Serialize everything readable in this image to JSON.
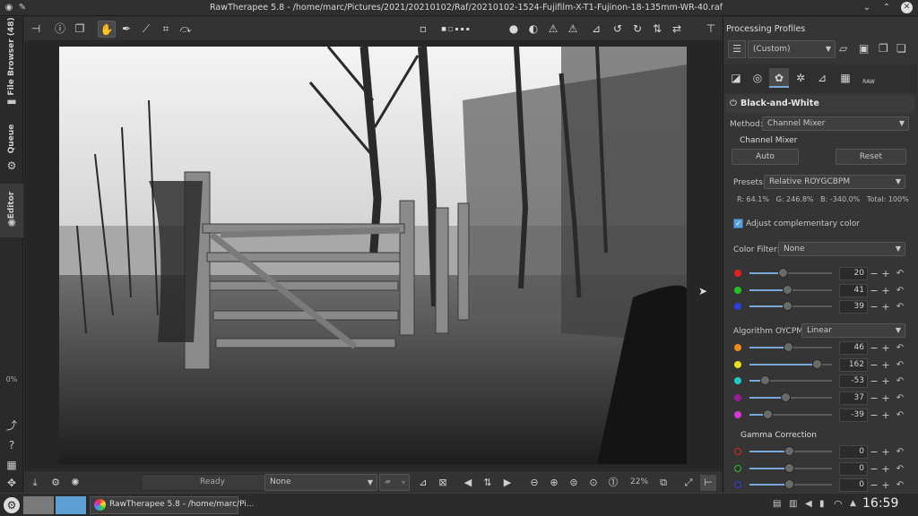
{
  "window": {
    "title": "RawTherapee 5.8 - /home/marc/Pictures/2021/20210102/Raf/20210102-1524-Fujifilm-X-T1-Fujinon-18-135mm-WR-40.raf"
  },
  "left_tabs": {
    "file_browser": "File Browser (48)",
    "queue": "Queue",
    "editor": "Editor",
    "progress": "0%"
  },
  "status": {
    "ready": "Ready",
    "profile_select": "None",
    "zoom": "22%"
  },
  "right": {
    "processing_profiles": "Processing Profiles",
    "profile_value": "(Custom)",
    "raw_tab_label": "RAW",
    "tool_title": "Black-and-White",
    "method_label": "Method:",
    "method_value": "Channel Mixer",
    "channel_mixer": "Channel Mixer",
    "auto": "Auto",
    "reset": "Reset",
    "presets_label": "Presets:",
    "presets_value": "Relative ROYGCBPM",
    "rgb_readout": "R: 64.1%   G: 246.8%   B: -340.0%   Total: 100%",
    "adjust_complementary": "Adjust complementary color",
    "adjust_checked": true,
    "color_filter_label": "Color Filter:",
    "color_filter_value": "None",
    "algorithm_label": "Algorithm OYCPM:",
    "algorithm_value": "Linear",
    "gamma_title": "Gamma Correction"
  },
  "sliders": {
    "mixer_rgb": [
      {
        "color": "#e02020",
        "value": "20",
        "fraction": 0.4
      },
      {
        "color": "#22c022",
        "value": "41",
        "fraction": 0.46
      },
      {
        "color": "#2a3fe0",
        "value": "39",
        "fraction": 0.46
      }
    ],
    "oycpm": [
      {
        "color": "#f08a1e",
        "value": "46",
        "fraction": 0.47
      },
      {
        "color": "#e6e020",
        "value": "162",
        "fraction": 0.82
      },
      {
        "color": "#20c8c8",
        "value": "-53",
        "fraction": 0.18
      },
      {
        "color": "#9a1a9a",
        "value": "37",
        "fraction": 0.44
      },
      {
        "color": "#d838d8",
        "value": "-39",
        "fraction": 0.22
      }
    ],
    "gamma": [
      {
        "color": "#e02020",
        "value": "0",
        "fraction": 0.48
      },
      {
        "color": "#22c022",
        "value": "0",
        "fraction": 0.48
      },
      {
        "color": "#2a3fe0",
        "value": "0",
        "fraction": 0.48
      }
    ]
  },
  "taskbar": {
    "app_label": "RawTherapee 5.8 - /home/marc/Pi...",
    "clock": "16:59"
  },
  "colors": {
    "accent": "#7aa7d9",
    "taskbar_active": "#5b9fd4"
  }
}
